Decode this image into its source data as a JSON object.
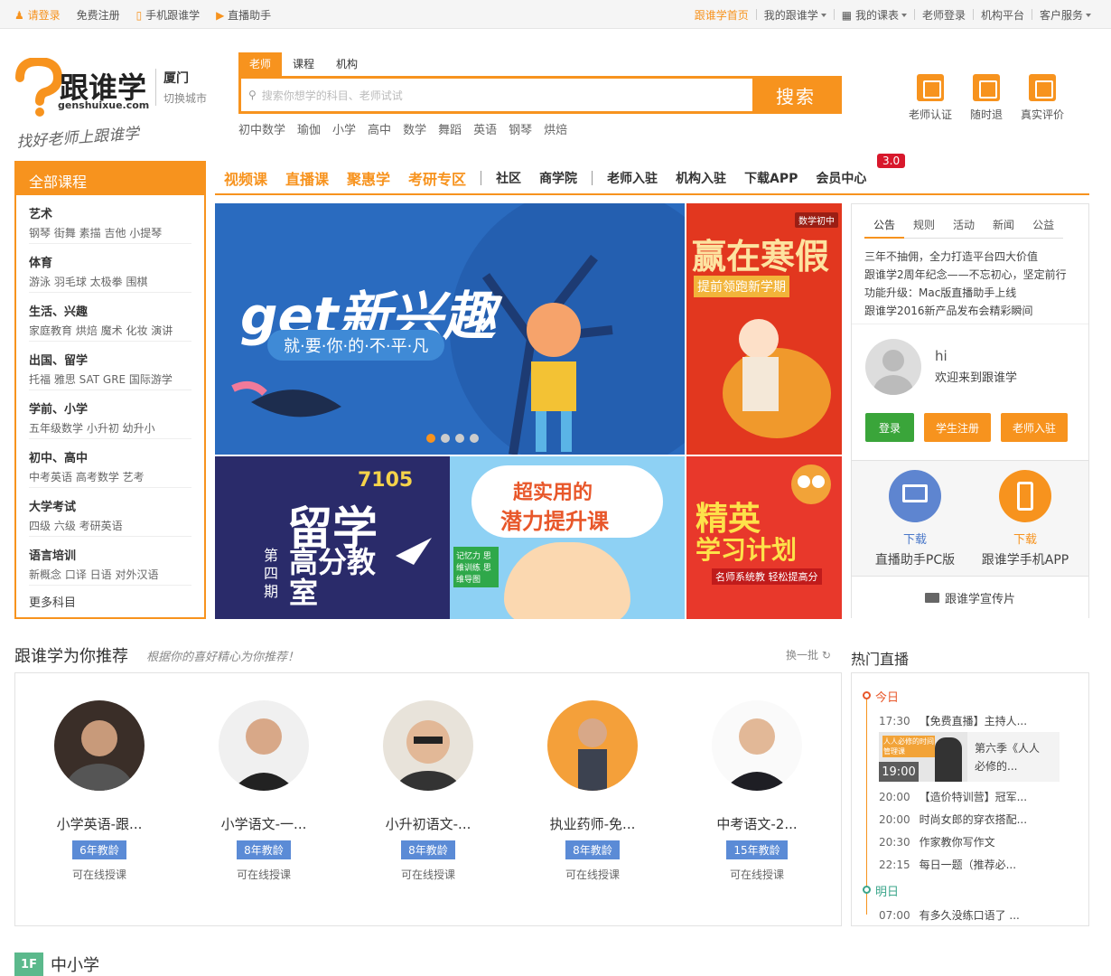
{
  "topbar": {
    "login": "请登录",
    "register": "免费注册",
    "mobile": "手机跟谁学",
    "live_helper": "直播助手",
    "home": "跟谁学首页",
    "my_gsx": "我的跟谁学",
    "my_schedule": "我的课表",
    "teacher_login": "老师登录",
    "org_platform": "机构平台",
    "service": "客户服务"
  },
  "header": {
    "logo_text": "跟谁学",
    "logo_domain": "genshuixue.com",
    "city": "厦门",
    "switch_city": "切换城市",
    "slogan": "找好老师上跟谁学",
    "search_tabs": [
      "老师",
      "课程",
      "机构"
    ],
    "search_placeholder": "搜索你想学的科目、老师试试",
    "search_button": "搜索",
    "hot_keywords": [
      "初中数学",
      "瑜伽",
      "小学",
      "高中",
      "数学",
      "舞蹈",
      "英语",
      "钢琴",
      "烘焙"
    ],
    "icons": [
      {
        "label": "老师认证",
        "icon": "teacher-cert-icon"
      },
      {
        "label": "随时退",
        "icon": "refund-icon"
      },
      {
        "label": "真实评价",
        "icon": "review-icon"
      }
    ]
  },
  "category": {
    "title": "全部课程",
    "groups": [
      {
        "title": "艺术",
        "items": "钢琴 街舞 素描 吉他 小提琴"
      },
      {
        "title": "体育",
        "items": "游泳 羽毛球 太极拳 围棋"
      },
      {
        "title": "生活、兴趣",
        "items": "家庭教育 烘焙 魔术 化妆 演讲"
      },
      {
        "title": "出国、留学",
        "items": "托福 雅思 SAT GRE 国际游学"
      },
      {
        "title": "学前、小学",
        "items": "五年级数学 小升初 幼升小"
      },
      {
        "title": "初中、高中",
        "items": "中考英语 高考数学 艺考"
      },
      {
        "title": "大学考试",
        "items": "四级 六级 考研英语"
      },
      {
        "title": "语言培训",
        "items": "新概念 口译 日语 对外汉语"
      }
    ],
    "more": "更多科目"
  },
  "nav": {
    "primary": [
      "视频课",
      "直播课",
      "聚惠学",
      "考研专区"
    ],
    "secondary": [
      "社区",
      "商学院"
    ],
    "tertiary": [
      "老师入驻",
      "机构入驻",
      "下载APP",
      "会员中心"
    ],
    "badge": "3.0"
  },
  "banners": {
    "main_title": "get新兴趣",
    "main_sub": "就·要·你·的·不·平·凡",
    "side_title": "赢在寒假",
    "side_sub": "提前领跑新学期",
    "side_tag": "数学初中",
    "b3_num": "7105",
    "b3_title1": "留学",
    "b3_title2": "高分教室",
    "b3_issue": "第四期",
    "b4_title1": "超实用的",
    "b4_title2": "潜力提升课",
    "b4_card": "记忆力 思维训练 思维导图",
    "b5_title1": "精英",
    "b5_title2": "学习计划",
    "b5_sub": "名师系统教 轻松提高分",
    "dots": 4
  },
  "notice": {
    "tabs": [
      "公告",
      "规则",
      "活动",
      "新闻",
      "公益"
    ],
    "items": [
      "三年不抽佣，全力打造平台四大价值",
      "跟谁学2周年纪念——不忘初心，坚定前行",
      "功能升级：Mac版直播助手上线",
      "跟谁学2016新产品发布会精彩瞬间"
    ]
  },
  "user": {
    "greet": "hi",
    "welcome": "欢迎来到跟谁学",
    "login": "登录",
    "student_register": "学生注册",
    "teacher_join": "老师入驻"
  },
  "downloads": [
    {
      "action": "下载",
      "label": "直播助手PC版"
    },
    {
      "action": "下载",
      "label": "跟谁学手机APP"
    }
  ],
  "promo_video": "跟谁学宣传片",
  "recommend": {
    "title": "跟谁学为你推荐",
    "subtitle": "根据你的喜好精心为你推荐！",
    "refresh": "换一批",
    "teachers": [
      {
        "name": "小学英语-跟...",
        "years": "6年教龄",
        "online": "可在线授课"
      },
      {
        "name": "小学语文-一...",
        "years": "8年教龄",
        "online": "可在线授课"
      },
      {
        "name": "小升初语文-...",
        "years": "8年教龄",
        "online": "可在线授课"
      },
      {
        "name": "执业药师-免...",
        "years": "8年教龄",
        "online": "可在线授课"
      },
      {
        "name": "中考语文-2...",
        "years": "15年教龄",
        "online": "可在线授课"
      }
    ]
  },
  "live": {
    "title": "热门直播",
    "today": "今日",
    "tomorrow": "明日",
    "featured": {
      "time": "19:00",
      "title1": "第六季《人人",
      "title2": "必修的...",
      "thumb": "人人必修的时间管理课"
    },
    "items_today": [
      {
        "time": "17:30",
        "title": "【免费直播】主持人..."
      },
      {
        "time": "20:00",
        "title": "【造价特训营】冠军..."
      },
      {
        "time": "20:00",
        "title": "时尚女郎的穿衣搭配..."
      },
      {
        "time": "20:30",
        "title": "作家教你写作文"
      },
      {
        "time": "22:15",
        "title": "每日一题（推荐必..."
      }
    ],
    "items_tomorrow": [
      {
        "time": "07:00",
        "title": "有多久没练口语了 ..."
      }
    ]
  },
  "floor": {
    "num": "1F",
    "title": "中小学"
  },
  "colors": {
    "accent": "#f7931e",
    "green": "#3aa53a",
    "blue_tag": "#5b8bd6",
    "badge": "#d8182c"
  }
}
